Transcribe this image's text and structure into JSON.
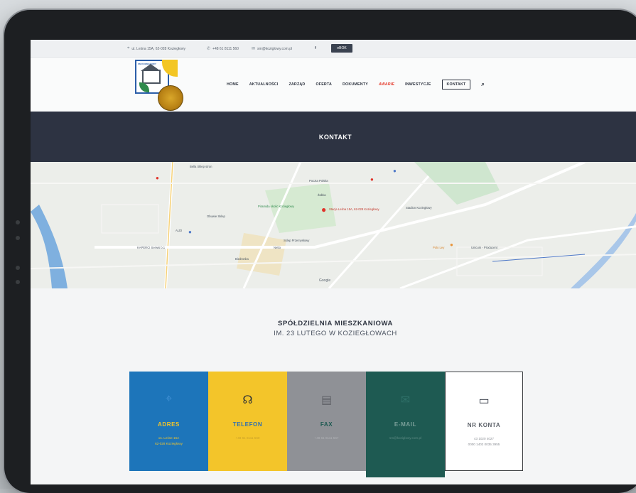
{
  "topbar": {
    "address": "ul. Leśna 15A, 62-028 Koziegłowy",
    "phone": "+48 61 8111 560",
    "email": "sm@koziglowy.com.pl",
    "facebook_label": "f",
    "ebok_label": "eBOK"
  },
  "logo": {
    "caption": "SM KOZIEGŁOWY"
  },
  "nav": {
    "items": [
      "HOME",
      "AKTUALNOŚCI",
      "ZARZĄD",
      "OFERTA",
      "DOKUMENTY",
      "AWARIE",
      "INWESTYCJE",
      "KONTAKT"
    ],
    "active": "AWARIE",
    "boxed": "KONTAKT"
  },
  "band": {
    "title": "KONTAKT"
  },
  "map": {
    "labels": [
      "Stacja Leśna 15A, 62-028 Koziegłowy",
      "Poczta Polska",
      "Żabka",
      "Piramida okolic Koziegłowy",
      "ALDI",
      "Netto",
      "Biedronka",
      "Obuwie Sklep",
      "KAPERCI Serwis b.1",
      "Sklep Przemysłowy",
      "Bella Sklep stron",
      "Google",
      "Stadion Koziegłowy",
      "Polo Ley",
      "Unicum - Producent"
    ],
    "google_label": "Google"
  },
  "org": {
    "line1": "SPÓŁDZIELNIA MIESZKANIOWA",
    "line2": "IM. 23 LUTEGO W KOZIEGŁOWACH"
  },
  "cards": [
    {
      "title": "ADRES",
      "text": "os. Leśne 15A\n62-028 Koziegłowy",
      "color": "#1d75ba"
    },
    {
      "title": "TELEFON",
      "text": "+48 61 8111 560",
      "color": "#f3c52a"
    },
    {
      "title": "FAX",
      "text": "+48 61 8111 567",
      "color": "#8f9196"
    },
    {
      "title": "E-MAIL",
      "text": "sm@koziglowy.com.pl",
      "color": "#1e5a52"
    },
    {
      "title": "NR KONTA",
      "text": "43 1020 4027\n0000 1402 0035 3955",
      "color": "#ffffff"
    }
  ]
}
